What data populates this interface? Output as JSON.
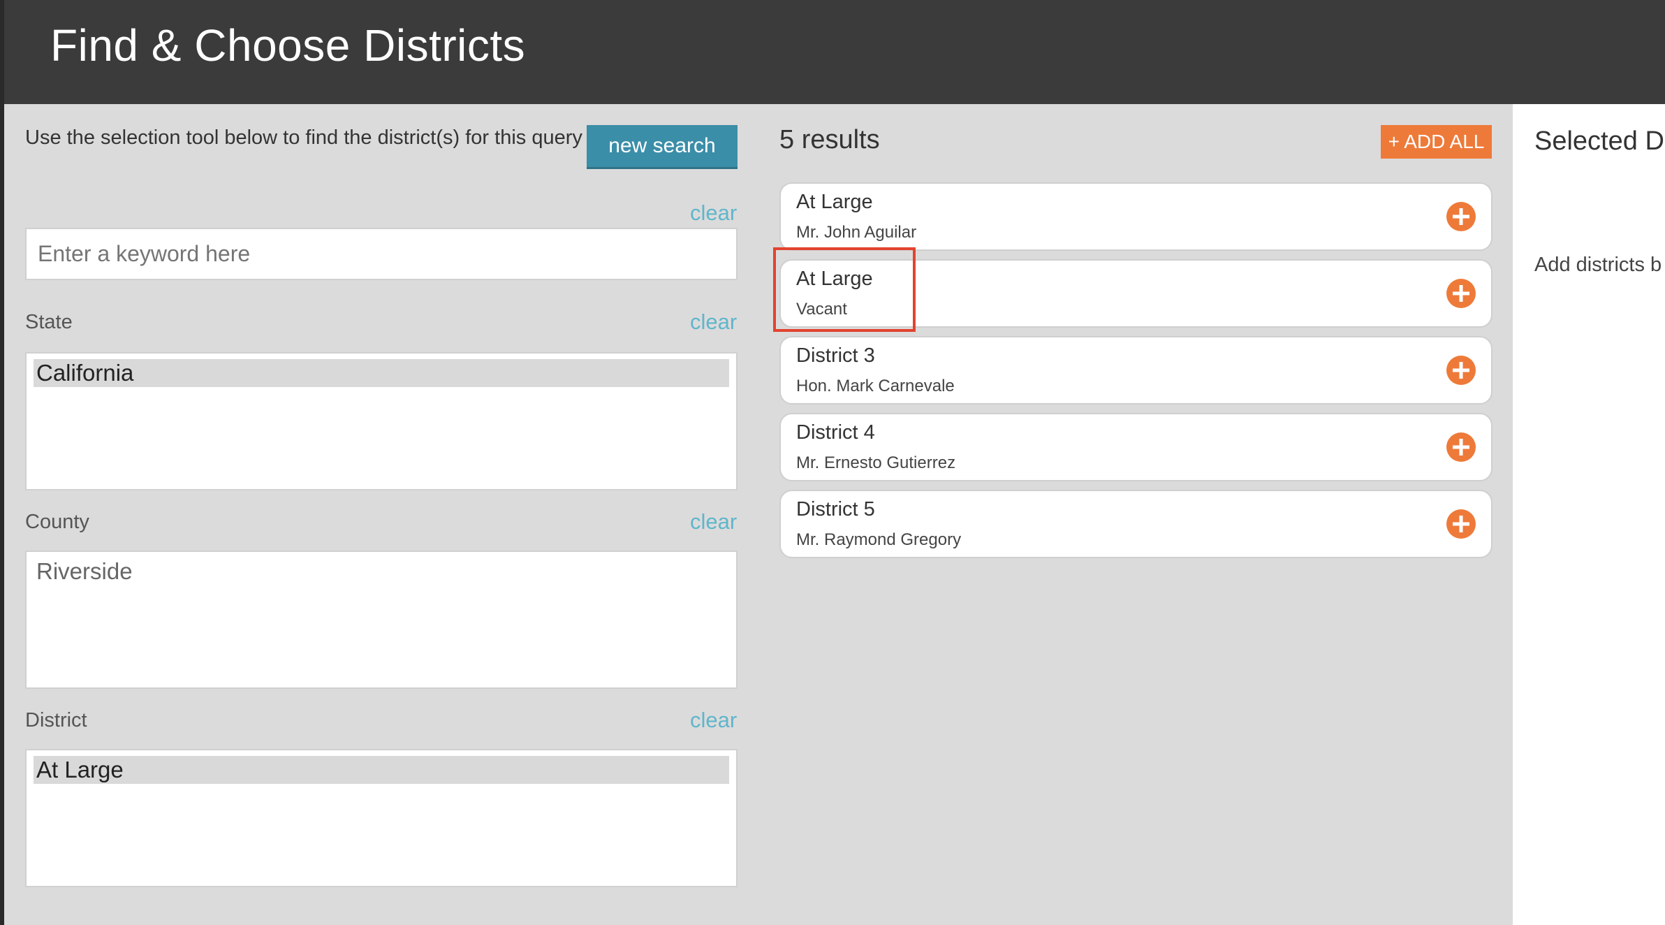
{
  "header": {
    "title": "Find & Choose Districts"
  },
  "search": {
    "instructions": "Use the selection tool below to find the district(s) for this query",
    "new_search_label": "new search",
    "keyword_placeholder": "Enter a keyword here",
    "keyword_value": "",
    "clear_label": "clear"
  },
  "filters": {
    "state": {
      "label": "State",
      "selected": "California"
    },
    "county": {
      "label": "County",
      "value": "Riverside"
    },
    "district": {
      "label": "District",
      "selected": "At Large"
    }
  },
  "results": {
    "count_label": "5 results",
    "add_all_label": "+ ADD ALL",
    "items": [
      {
        "title": "At Large",
        "subtitle": "Mr. John Aguilar"
      },
      {
        "title": "At Large",
        "subtitle": "Vacant"
      },
      {
        "title": "District 3",
        "subtitle": "Hon. Mark Carnevale"
      },
      {
        "title": "District 4",
        "subtitle": "Mr. Ernesto Gutierrez"
      },
      {
        "title": "District 5",
        "subtitle": "Mr. Raymond Gregory"
      }
    ]
  },
  "selected_panel": {
    "title": "Selected Dis",
    "hint": "Add districts b"
  },
  "colors": {
    "header_bg": "#3b3b3b",
    "accent_orange": "#ee7a39",
    "accent_teal": "#3b8ea8",
    "link_teal": "#5fb6cb",
    "highlight_red": "#e2432f"
  }
}
